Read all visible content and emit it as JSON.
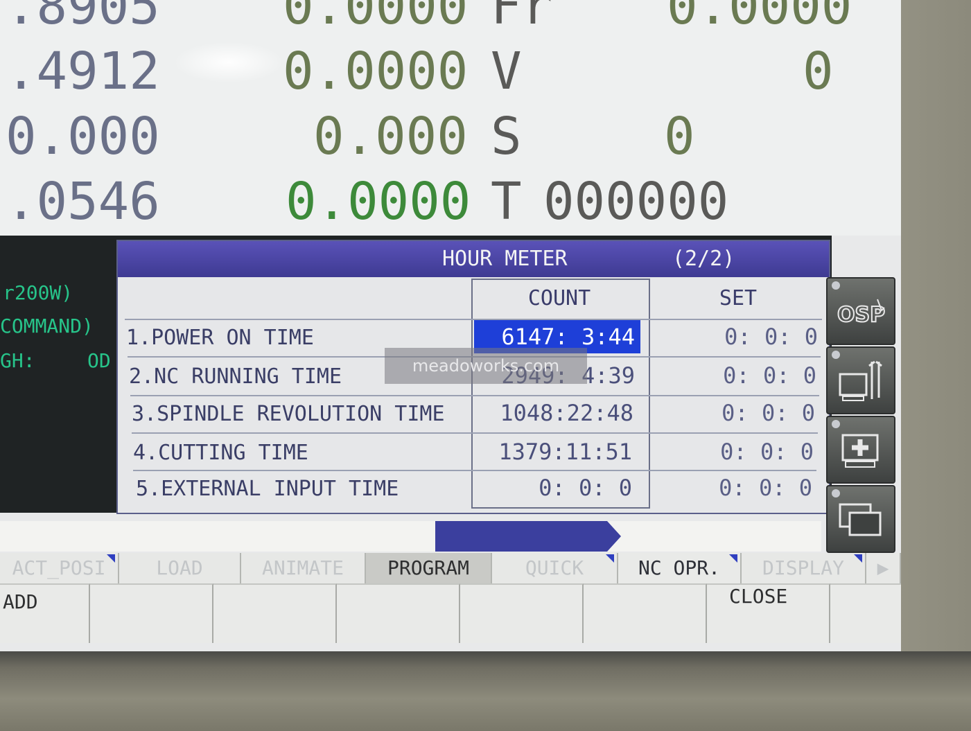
{
  "position_display": {
    "rows": [
      {
        "col1": ".8905",
        "col2": "0.0000",
        "label": "Fr",
        "value": "0.0000"
      },
      {
        "col1": ".4912",
        "col2": "0.0000",
        "label": "V",
        "value": "0"
      },
      {
        "col1": "0.000",
        "col2": "0.000",
        "label": "S",
        "value": "0"
      },
      {
        "col1": ".0546",
        "col2": "0.0000",
        "label": "T",
        "value": "000000"
      }
    ]
  },
  "side_info": {
    "line1": "r200W)",
    "line2": "COMMAND)",
    "line3_left": "GH:",
    "line3_right": "OD"
  },
  "dialog": {
    "title": "HOUR METER",
    "page": "(2/2)",
    "col_count": "COUNT",
    "col_set": "SET",
    "rows": [
      {
        "label": "1.POWER ON TIME",
        "count": "6147: 3:44",
        "set": "0: 0: 0",
        "selected": true
      },
      {
        "label": "2.NC RUNNING TIME",
        "count": "2949: 4:39",
        "set": "0: 0: 0"
      },
      {
        "label": "3.SPINDLE REVOLUTION TIME",
        "count": "1048:22:48",
        "set": "0: 0: 0"
      },
      {
        "label": "4.CUTTING TIME",
        "count": "1379:11:51",
        "set": "0: 0: 0"
      },
      {
        "label": "5.EXTERNAL INPUT TIME",
        "count": "0: 0: 0",
        "set": "0: 0: 0"
      }
    ]
  },
  "watermark": "meadoworks.com",
  "side_buttons": [
    "osp-logo-icon",
    "maintenance-tools-icon",
    "medical-cross-icon",
    "windows-icon"
  ],
  "tabs": [
    {
      "label": "ACT_POSI",
      "state": "dim"
    },
    {
      "label": "LOAD",
      "state": "dim"
    },
    {
      "label": "ANIMATE",
      "state": "dim"
    },
    {
      "label": "PROGRAM",
      "state": "active"
    },
    {
      "label": "QUICK",
      "state": "dim"
    },
    {
      "label": "NC OPR.",
      "state": "normal"
    },
    {
      "label": "DISPLAY",
      "state": "dim"
    }
  ],
  "function_keys": [
    "ADD",
    "",
    "",
    "",
    "",
    "",
    "CLOSE",
    ""
  ],
  "colors": {
    "title_bar": "#3e3a92",
    "selection": "#1e3fd8",
    "progress": "#3b3f9e",
    "accent_green": "#27c48a"
  }
}
